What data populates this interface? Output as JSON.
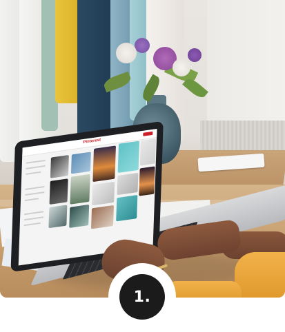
{
  "photo": {
    "description_icon": "photo-workspace-laptop",
    "screen_site_logo": "Pinterest"
  },
  "step": {
    "label": "1.",
    "badge_color": "#1b1b1b",
    "ring_color": "#ffffff"
  }
}
